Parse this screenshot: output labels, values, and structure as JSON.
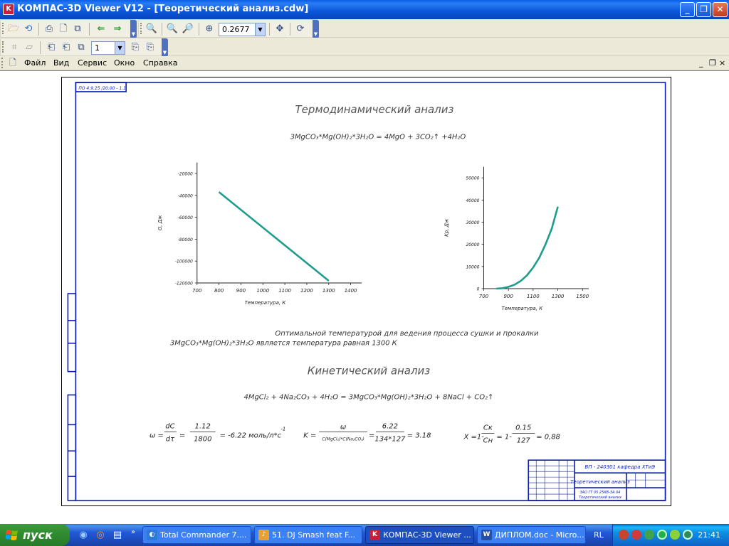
{
  "window": {
    "title": "КОМПАС-3D Viewer V12 - [Теоретический анализ.cdw]",
    "controls": [
      "_",
      "❐",
      "✕"
    ]
  },
  "toolbar": {
    "zoom_value": "0.2677",
    "page_value": "1"
  },
  "menu": {
    "items": [
      "Файл",
      "Вид",
      "Сервис",
      "Окно",
      "Справка"
    ],
    "mdi_controls": [
      "_",
      "❐",
      "×"
    ]
  },
  "drawing": {
    "stamp_corner": "ПО 4.9.25 /20.00 - 1.1",
    "section1_title": "Термодинамический анализ",
    "equation1": "3MgCO₃*Mg(OH)₂*3H₂O = 4MgO + 3CO₂↑ +4H₂O",
    "conclusion_line1": "Оптимальной температурой для ведения процесса сушки и прокалки",
    "conclusion_line2": "3MgCO₃*Mg(OH)₂*3H₂O является температура равная 1300 К",
    "section2_title": "Кинетический анализ",
    "equation2": "4MgCl₂ + 4Na₂CO₃ + 4H₂O = 3MgCO₃*Mg(OH)₂*3H₂O + 8NaCl + CO₂↑",
    "formula_omega": {
      "lhs": "ω =",
      "frac1_num": "dC",
      "frac1_den": "dτ",
      "frac2_num": "1.12",
      "frac2_den": "1800",
      "rhs": "= -6.22 моль/л*с",
      "exp": "-1"
    },
    "formula_k": {
      "lhs": "K =",
      "frac1_num": "ω",
      "frac1_den": "C(MgCl₂)*C(Na₂CO₃)",
      "frac2_num": "6.22",
      "frac2_den": "134*127",
      "rhs": "= 3.18"
    },
    "formula_x": {
      "lhs": "X =1-",
      "frac1_num": "Cк",
      "frac1_den": "Cн",
      "mid": "= 1-",
      "frac2_num": "0.15",
      "frac2_den": "127",
      "rhs": "= 0,88"
    },
    "title_block": {
      "code": "ВП - 240301 кафедра ХТиЭ",
      "name": "Теоретический анализ",
      "org_line1": "ЗАО ГТ 05 25КВ-ЗА 04",
      "org_line2": "Теоретический анализ"
    }
  },
  "chart_data": [
    {
      "type": "line",
      "title": "",
      "xlabel": "Температура, К",
      "ylabel": "G, Дж",
      "x_ticks": [
        700,
        800,
        900,
        1000,
        1100,
        1200,
        1300,
        1400
      ],
      "y_ticks": [
        -20000,
        -40000,
        -60000,
        -80000,
        -100000,
        -120000
      ],
      "y_tick_labels": [
        "-20000",
        "-40000",
        "-60000",
        "-80000",
        "-100000",
        "-120000"
      ],
      "xlim": [
        700,
        1450
      ],
      "ylim": [
        -120000,
        -10000
      ],
      "series": [
        {
          "color": "#1e9c8c",
          "x": [
            800,
            1300
          ],
          "y": [
            -37000,
            -118000
          ]
        }
      ]
    },
    {
      "type": "line",
      "title": "",
      "xlabel": "Температура, К",
      "ylabel": "Kp, Дж",
      "x_ticks": [
        700,
        900,
        1100,
        1300,
        1500
      ],
      "y_ticks": [
        0,
        10000,
        20000,
        30000,
        40000,
        50000
      ],
      "y_tick_labels": [
        "0",
        "10000",
        "20000",
        "30000",
        "40000",
        "50000"
      ],
      "xlim": [
        700,
        1550
      ],
      "ylim": [
        0,
        55000
      ],
      "series": [
        {
          "color": "#1e9c8c",
          "x": [
            800,
            850,
            900,
            950,
            1000,
            1050,
            1100,
            1150,
            1200,
            1250,
            1300
          ],
          "y": [
            0,
            200,
            800,
            1800,
            3500,
            6000,
            9500,
            14000,
            20000,
            27000,
            37000
          ]
        }
      ]
    }
  ],
  "taskbar": {
    "start_label": "пуск",
    "tasks": [
      "Total Commander 7....",
      "51. DJ Smash feat F...",
      "КОМПАС-3D Viewer ...",
      "ДИПЛОМ.doc - Micro..."
    ],
    "lang": "RL",
    "clock": "21:41"
  }
}
